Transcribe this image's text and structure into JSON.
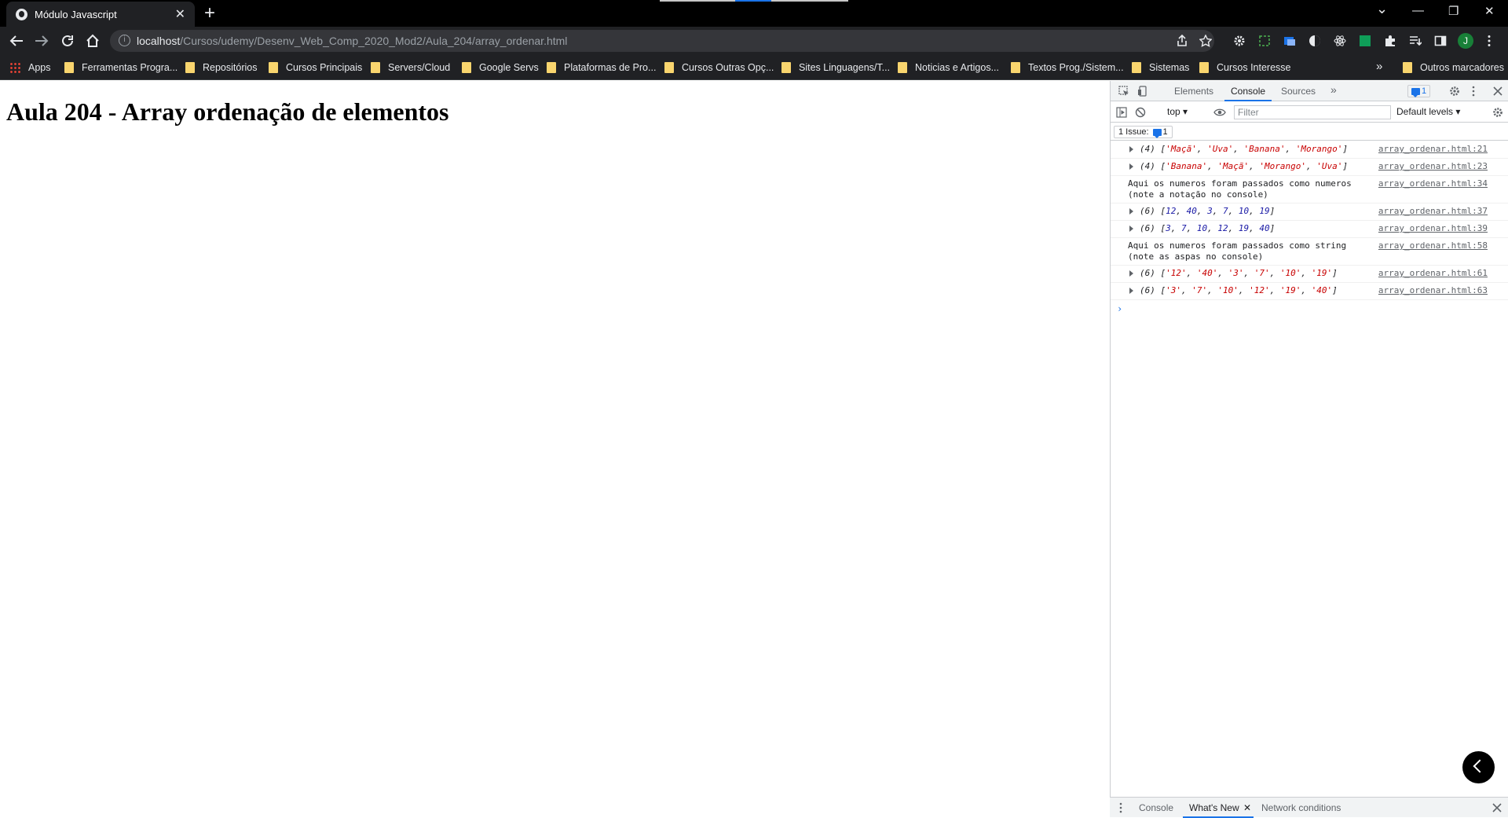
{
  "window": {
    "tab_title": "Módulo Javascript",
    "tab_close": "✕",
    "new_tab": "+",
    "minimize": "—",
    "restore": "❐",
    "close": "✕",
    "tab_search": "⌄"
  },
  "toolbar": {
    "url_host": "localhost",
    "url_path": "/Cursos/udemy/Desenv_Web_Comp_2020_Mod2/Aula_204/array_ordenar.html",
    "profile_initial": "J"
  },
  "bookmarks": {
    "items": [
      {
        "label": "Apps",
        "icon": "apps-grid-icon"
      },
      {
        "label": "Ferramentas Progra...",
        "icon": "folder-icon"
      },
      {
        "label": "Repositórios",
        "icon": "folder-icon"
      },
      {
        "label": "Cursos Principais",
        "icon": "folder-icon"
      },
      {
        "label": "Servers/Cloud",
        "icon": "folder-icon"
      },
      {
        "label": "Google Servs",
        "icon": "folder-icon"
      },
      {
        "label": "Plataformas de Pro...",
        "icon": "folder-icon"
      },
      {
        "label": "Cursos Outras Opç...",
        "icon": "folder-icon"
      },
      {
        "label": "Sites Linguagens/T...",
        "icon": "folder-icon"
      },
      {
        "label": "Noticias e Artigos...",
        "icon": "folder-icon"
      },
      {
        "label": "Textos Prog./Sistem...",
        "icon": "folder-icon"
      },
      {
        "label": "Sistemas",
        "icon": "folder-icon"
      },
      {
        "label": "Cursos Interesse",
        "icon": "folder-icon"
      }
    ],
    "overflow": "»",
    "other": "Outros marcadores"
  },
  "page": {
    "heading": "Aula 204 - Array ordenação de elementos"
  },
  "devtools": {
    "tabs": [
      "Elements",
      "Console",
      "Sources"
    ],
    "active_tab": "Console",
    "more_tabs": "»",
    "issue_count": "1",
    "context": "top",
    "filter_placeholder": "Filter",
    "levels": "Default levels",
    "issues_label": "1 Issue:",
    "issues_count": "1",
    "log": [
      {
        "type": "array",
        "count": "(4)",
        "items": [
          {
            "v": "'Maçã'",
            "k": "str"
          },
          {
            "v": "'Uva'",
            "k": "str"
          },
          {
            "v": "'Banana'",
            "k": "str"
          },
          {
            "v": "'Morango'",
            "k": "str"
          }
        ],
        "source": "array_ordenar.html:21"
      },
      {
        "type": "array",
        "count": "(4)",
        "items": [
          {
            "v": "'Banana'",
            "k": "str"
          },
          {
            "v": "'Maçã'",
            "k": "str"
          },
          {
            "v": "'Morango'",
            "k": "str"
          },
          {
            "v": "'Uva'",
            "k": "str"
          }
        ],
        "source": "array_ordenar.html:23"
      },
      {
        "type": "text",
        "lines": [
          "Aqui os numeros foram passados como numeros",
          "(note a notação no console)"
        ],
        "source": "array_ordenar.html:34"
      },
      {
        "type": "array",
        "count": "(6)",
        "items": [
          {
            "v": "12",
            "k": "num"
          },
          {
            "v": "40",
            "k": "num"
          },
          {
            "v": "3",
            "k": "num"
          },
          {
            "v": "7",
            "k": "num"
          },
          {
            "v": "10",
            "k": "num"
          },
          {
            "v": "19",
            "k": "num"
          }
        ],
        "source": "array_ordenar.html:37"
      },
      {
        "type": "array",
        "count": "(6)",
        "items": [
          {
            "v": "3",
            "k": "num"
          },
          {
            "v": "7",
            "k": "num"
          },
          {
            "v": "10",
            "k": "num"
          },
          {
            "v": "12",
            "k": "num"
          },
          {
            "v": "19",
            "k": "num"
          },
          {
            "v": "40",
            "k": "num"
          }
        ],
        "source": "array_ordenar.html:39"
      },
      {
        "type": "text",
        "lines": [
          "Aqui os numeros foram passados como string",
          "(note as aspas no console)"
        ],
        "source": "array_ordenar.html:58"
      },
      {
        "type": "array",
        "count": "(6)",
        "items": [
          {
            "v": "'12'",
            "k": "str"
          },
          {
            "v": "'40'",
            "k": "str"
          },
          {
            "v": "'3'",
            "k": "str"
          },
          {
            "v": "'7'",
            "k": "str"
          },
          {
            "v": "'10'",
            "k": "str"
          },
          {
            "v": "'19'",
            "k": "str"
          }
        ],
        "source": "array_ordenar.html:61"
      },
      {
        "type": "array",
        "count": "(6)",
        "items": [
          {
            "v": "'3'",
            "k": "str"
          },
          {
            "v": "'7'",
            "k": "str"
          },
          {
            "v": "'10'",
            "k": "str"
          },
          {
            "v": "'12'",
            "k": "str"
          },
          {
            "v": "'19'",
            "k": "str"
          },
          {
            "v": "'40'",
            "k": "str"
          }
        ],
        "source": "array_ordenar.html:63"
      }
    ],
    "prompt": "›",
    "drawer_tabs": [
      "Console",
      "What's New",
      "Network conditions"
    ],
    "drawer_active": "What's New"
  }
}
